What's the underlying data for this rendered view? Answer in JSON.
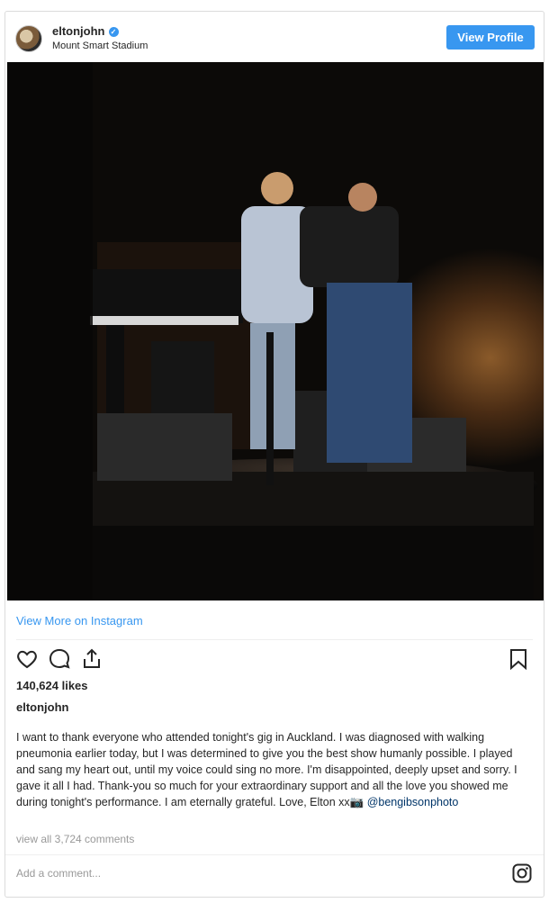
{
  "header": {
    "username": "eltonjohn",
    "location": "Mount Smart Stadium",
    "view_profile_label": "View Profile"
  },
  "photo": {
    "subject": "concert-stage-photo"
  },
  "links": {
    "view_more": "View More on Instagram"
  },
  "actions": {
    "icons": [
      "heart-icon",
      "comment-icon",
      "share-icon",
      "bookmark-icon"
    ]
  },
  "post": {
    "likes": "140,624 likes",
    "caption_username": "eltonjohn",
    "caption_text": "I want to thank everyone who attended tonight's gig in Auckland. I was diagnosed with walking pneumonia earlier today, but I was determined to give you the best show humanly possible. I played and sang my heart out, until my voice could sing no more. I'm disappointed, deeply upset and sorry. I gave it all I had. Thank-you so much for your extraordinary support and all the love you showed me during tonight's performance. I am eternally grateful. Love, Elton xx📷 ",
    "caption_mention": "@bengibsonphoto",
    "view_all_comments": "view all 3,724 comments"
  },
  "comment_box": {
    "placeholder": "Add a comment..."
  },
  "colors": {
    "accent": "#3897f0",
    "border": "#dbdbdb",
    "text": "#262626",
    "muted": "#999999"
  }
}
